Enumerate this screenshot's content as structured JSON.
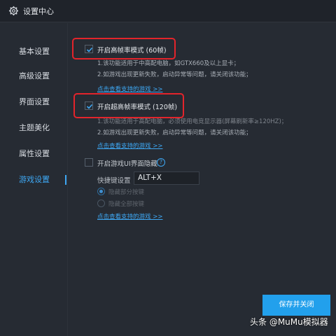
{
  "window": {
    "title": "设置中心"
  },
  "sidebar": {
    "items": [
      {
        "label": "基本设置"
      },
      {
        "label": "高级设置"
      },
      {
        "label": "界面设置"
      },
      {
        "label": "主题美化"
      },
      {
        "label": "属性设置"
      },
      {
        "label": "游戏设置",
        "active": true
      }
    ]
  },
  "options": {
    "fps60": {
      "checked": true,
      "label": "开启高帧率模式 (60帧)",
      "desc1": "1.该功能适用于中高配电脑，如GTX660及以上显卡；",
      "desc2": "2.如游戏出现更新失败，启动异常等问题，请关闭该功能；",
      "link": "点击查看支持的游戏 >>"
    },
    "fps120": {
      "checked": true,
      "label": "开启超高帧率模式 (120帧)",
      "desc1": "1.该功能适用于高配电脑，必须使用电竞显示器(屏幕刷新率≥120HZ)；",
      "desc2": "2.如游戏出现更新失败，启动异常等问题，请关闭该功能；",
      "link": "点击查看支持的游戏 >>"
    },
    "hideui": {
      "checked": false,
      "label": "开启游戏UI界面隐藏",
      "help": "?",
      "hotkey_label": "快捷键设置",
      "hotkey_value": "ALT+X",
      "radio1": {
        "label": "隐藏部分按键",
        "checked": true
      },
      "radio2": {
        "label": "隐藏全部按键",
        "checked": false
      },
      "link": "点击查看支持的游戏 >>"
    }
  },
  "footer": {
    "save_label": "保存并关闭",
    "watermark": "头条 @MuMu模拟器"
  },
  "colors": {
    "accent": "#3ea8f4",
    "highlight": "#e3242b",
    "button": "#22a0ec",
    "background": "#262b33"
  },
  "icons": {
    "title": "gear-icon",
    "checkbox": "check-icon",
    "help": "question-icon"
  }
}
